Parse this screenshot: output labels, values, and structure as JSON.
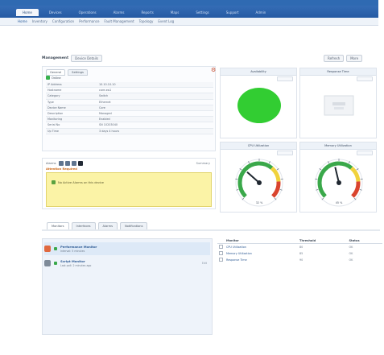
{
  "nav": {
    "tabs": [
      {
        "label": "Home",
        "active": true
      },
      {
        "label": "Devices"
      },
      {
        "label": "Operations"
      },
      {
        "label": "Alarms"
      },
      {
        "label": "Reports"
      },
      {
        "label": "Maps"
      },
      {
        "label": "Settings"
      },
      {
        "label": "Support"
      },
      {
        "label": "Admin"
      }
    ]
  },
  "subnav": [
    "Home",
    "Inventory",
    "Configuration",
    "Performance",
    "Fault Management",
    "Topology",
    "Event Log"
  ],
  "header": {
    "crumb": "Management",
    "device": "Device Details",
    "btn_refresh": "Refresh",
    "btn_more": "More"
  },
  "details": {
    "tabs": [
      "General",
      "Settings"
    ],
    "status": "Online",
    "properties": [
      {
        "k": "IP Address",
        "v": "10.10.10.10"
      },
      {
        "k": "Hostname",
        "v": "core-sw1"
      },
      {
        "k": "Category",
        "v": "Switch"
      },
      {
        "k": "Type",
        "v": "Ethernet"
      },
      {
        "k": "Device Name",
        "v": "Core"
      },
      {
        "k": "Description",
        "v": "Managed"
      },
      {
        "k": "Monitoring",
        "v": "Enabled"
      },
      {
        "k": "Serial No",
        "v": "SN 10203040"
      },
      {
        "k": "Up Time",
        "v": "3 days 4 hours"
      }
    ]
  },
  "alarms": {
    "label": "Alarms",
    "view": "Summary",
    "warn_title": "Attention Required",
    "message": "No Active Alarms on this device"
  },
  "cards": [
    {
      "title": "Availability",
      "kind": "dot"
    },
    {
      "title": "Response Time",
      "kind": "box"
    },
    {
      "title": "CPU Utilization",
      "kind": "gauge",
      "value": 0.32,
      "label": "32 %"
    },
    {
      "title": "Memory Utilization",
      "kind": "gauge",
      "value": 0.45,
      "label": "45 %"
    }
  ],
  "bottom_tabs": [
    {
      "label": "Monitors",
      "active": true
    },
    {
      "label": "Interfaces"
    },
    {
      "label": "Alarms"
    },
    {
      "label": "Notifications"
    }
  ],
  "list": [
    {
      "title": "Performance Monitor",
      "sub": "Interval: 5 minutes",
      "color": "#e0693f",
      "badge": "",
      "selected": true
    },
    {
      "title": "Script Monitor",
      "sub": "Last poll: 2 minutes ago",
      "color": "#7f8b99",
      "badge": "Edit",
      "selected": false
    }
  ],
  "table": {
    "headers": [
      "Monitor",
      "Threshold",
      "Status"
    ],
    "rows": [
      {
        "name": "CPU Utilization",
        "th": "80",
        "st": "OK"
      },
      {
        "name": "Memory Utilization",
        "th": "85",
        "st": "OK"
      },
      {
        "name": "Response Time",
        "th": "90",
        "st": "OK"
      }
    ]
  },
  "colors": {
    "header": "#2f6ab2",
    "green": "#32cd32",
    "yellow": "#fbf3a6"
  }
}
